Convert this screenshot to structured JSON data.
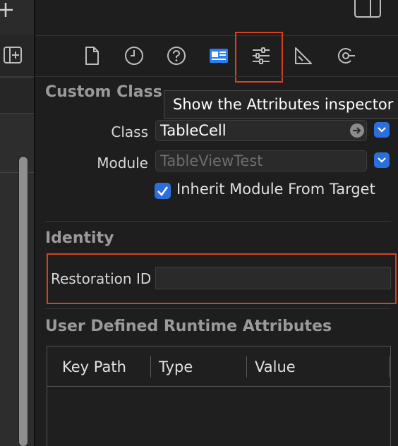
{
  "toolbar": {
    "tabs": [
      "file-inspector",
      "history-inspector",
      "quick-help-inspector",
      "identity-inspector",
      "attributes-inspector",
      "size-inspector",
      "connections-inspector"
    ],
    "selected_tab": "identity-inspector",
    "highlight_color": "#d8411f",
    "accent_color": "#2b6fdd"
  },
  "tooltip": {
    "text": "Show the Attributes inspector"
  },
  "custom_class": {
    "title": "Custom Class",
    "class_label": "Class",
    "class_value": "TableCell",
    "module_label": "Module",
    "module_placeholder": "TableViewTest",
    "inherit_label": "Inherit Module From Target",
    "inherit_checked": true
  },
  "identity": {
    "title": "Identity",
    "restoration_label": "Restoration ID",
    "restoration_value": ""
  },
  "runtime_attributes": {
    "title": "User Defined Runtime Attributes",
    "columns": [
      "Key Path",
      "Type",
      "Value"
    ]
  }
}
